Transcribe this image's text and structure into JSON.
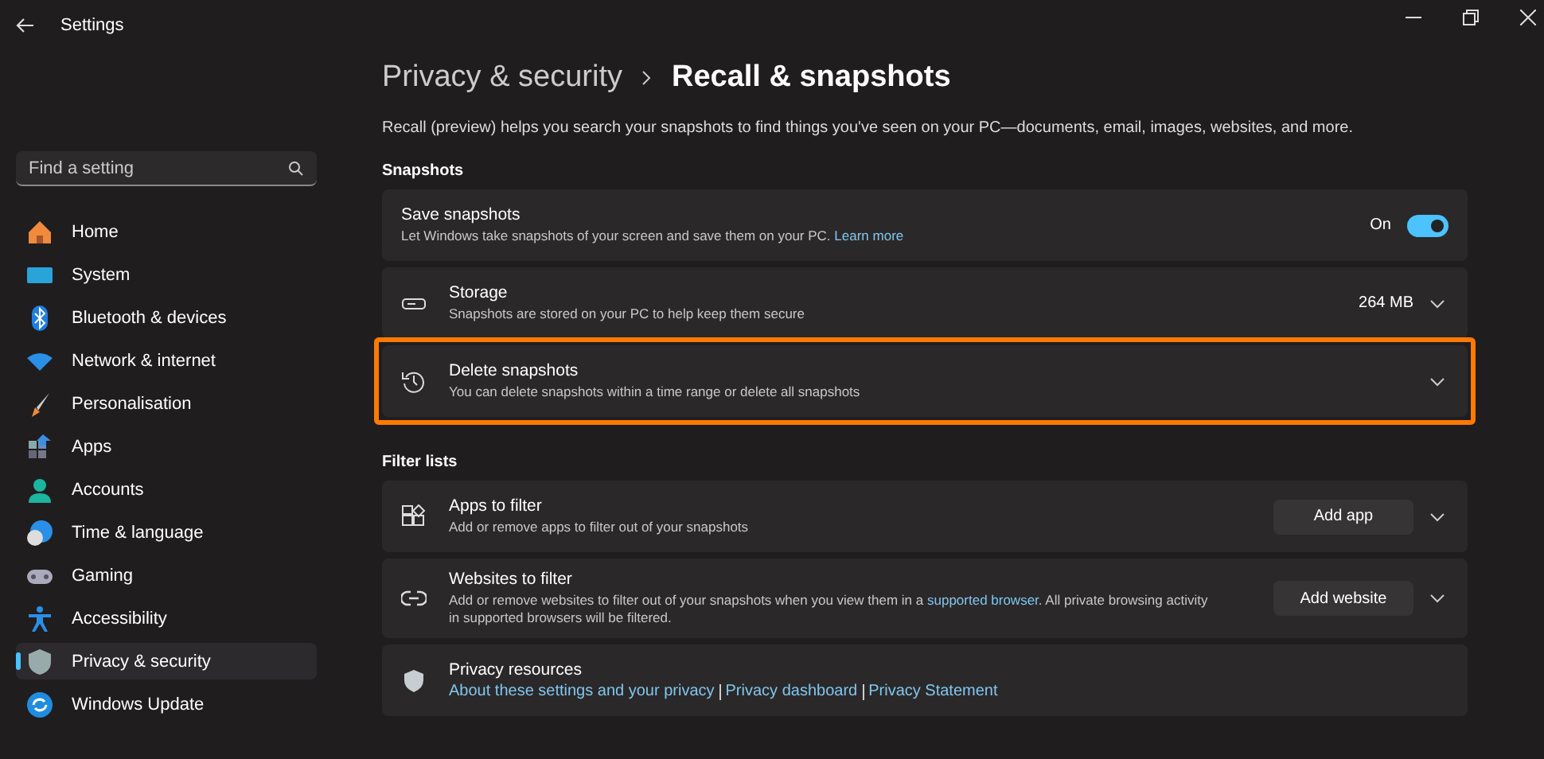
{
  "window": {
    "title": "Settings"
  },
  "search": {
    "placeholder": "Find a setting"
  },
  "sidebar": {
    "items": [
      {
        "label": "Home",
        "selected": false
      },
      {
        "label": "System",
        "selected": false
      },
      {
        "label": "Bluetooth & devices",
        "selected": false
      },
      {
        "label": "Network & internet",
        "selected": false
      },
      {
        "label": "Personalisation",
        "selected": false
      },
      {
        "label": "Apps",
        "selected": false
      },
      {
        "label": "Accounts",
        "selected": false
      },
      {
        "label": "Time & language",
        "selected": false
      },
      {
        "label": "Gaming",
        "selected": false
      },
      {
        "label": "Accessibility",
        "selected": false
      },
      {
        "label": "Privacy & security",
        "selected": true
      },
      {
        "label": "Windows Update",
        "selected": false
      }
    ]
  },
  "breadcrumb": {
    "parent": "Privacy & security",
    "current": "Recall & snapshots"
  },
  "intro": "Recall (preview) helps you search your snapshots to find things you've seen on your PC—documents, email, images, websites, and more.",
  "sections": [
    {
      "title": "Snapshots",
      "cards": [
        {
          "kind": "toggle",
          "title": "Save snapshots",
          "description": "Let Windows take snapshots of your screen and save them on your PC.",
          "link": "Learn more",
          "state_label": "On",
          "on": true
        },
        {
          "kind": "value",
          "title": "Storage",
          "description": "Snapshots are stored on your PC to help keep them secure",
          "value": "264 MB"
        },
        {
          "kind": "expand",
          "title": "Delete snapshots",
          "description": "You can delete snapshots within a time range or delete all snapshots",
          "highlighted": true
        }
      ]
    },
    {
      "title": "Filter lists",
      "cards": [
        {
          "kind": "button",
          "title": "Apps to filter",
          "description": "Add or remove apps to filter out of your snapshots",
          "button": "Add app"
        },
        {
          "kind": "button",
          "title": "Websites to filter",
          "description": "Add or remove websites to filter out of your snapshots when you view them in a",
          "link": "supported browser",
          "description_after": ". All private browsing activity in supported browsers will be filtered.",
          "button": "Add website"
        },
        {
          "kind": "links",
          "title": "Privacy resources",
          "links": [
            "About these settings and your privacy",
            "Privacy dashboard",
            "Privacy Statement"
          ]
        }
      ]
    }
  ]
}
